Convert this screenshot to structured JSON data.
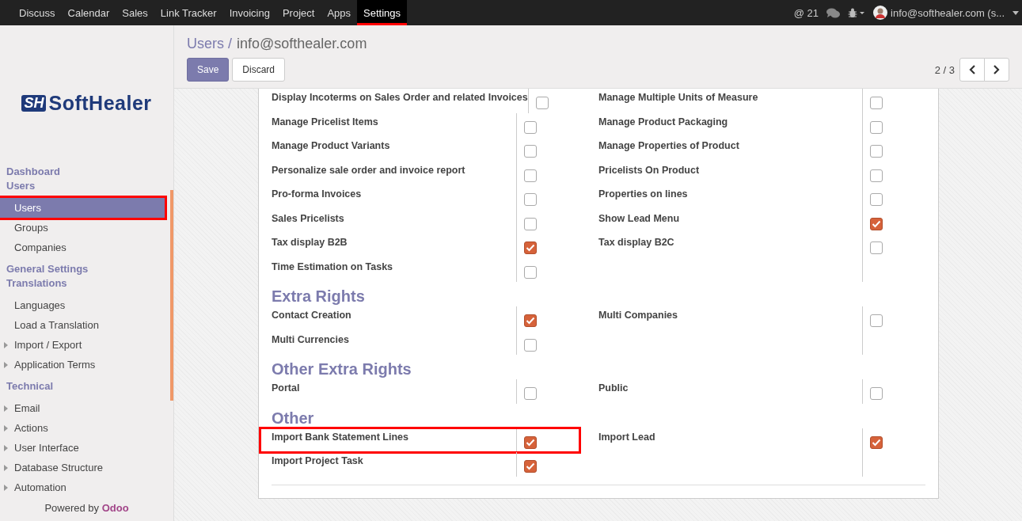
{
  "navbar": {
    "items": [
      {
        "label": "Discuss",
        "selected": false,
        "highlighted": false
      },
      {
        "label": "Calendar",
        "selected": false,
        "highlighted": false
      },
      {
        "label": "Sales",
        "selected": false,
        "highlighted": false
      },
      {
        "label": "Link Tracker",
        "selected": false,
        "highlighted": false
      },
      {
        "label": "Invoicing",
        "selected": false,
        "highlighted": false
      },
      {
        "label": "Project",
        "selected": false,
        "highlighted": false
      },
      {
        "label": "Apps",
        "selected": false,
        "highlighted": false
      },
      {
        "label": "Settings",
        "selected": true,
        "highlighted": true
      }
    ],
    "mentions": "@ 21",
    "user": "info@softhealer.com (s..."
  },
  "sidebar": {
    "logo": {
      "mark": "SH",
      "name": "SoftHealer"
    },
    "items": [
      {
        "kind": "header",
        "label": "Dashboard"
      },
      {
        "kind": "header",
        "label": "Users"
      },
      {
        "kind": "item",
        "label": "Users",
        "selected": true,
        "highlighted": true
      },
      {
        "kind": "item",
        "label": "Groups",
        "selected": false,
        "highlighted": false
      },
      {
        "kind": "item",
        "label": "Companies",
        "selected": false,
        "highlighted": false
      },
      {
        "kind": "header",
        "label": "General Settings"
      },
      {
        "kind": "header",
        "label": "Translations"
      },
      {
        "kind": "item",
        "label": "Languages",
        "selected": false,
        "highlighted": false
      },
      {
        "kind": "item",
        "label": "Load a Translation",
        "selected": false,
        "highlighted": false
      },
      {
        "kind": "folder",
        "label": "Import / Export",
        "selected": false,
        "highlighted": false
      },
      {
        "kind": "folder",
        "label": "Application Terms",
        "selected": false,
        "highlighted": false
      },
      {
        "kind": "header",
        "label": "Technical"
      },
      {
        "kind": "folder",
        "label": "Email",
        "selected": false,
        "highlighted": false
      },
      {
        "kind": "folder",
        "label": "Actions",
        "selected": false,
        "highlighted": false
      },
      {
        "kind": "folder",
        "label": "User Interface",
        "selected": false,
        "highlighted": false
      },
      {
        "kind": "folder",
        "label": "Database Structure",
        "selected": false,
        "highlighted": false
      },
      {
        "kind": "folder",
        "label": "Automation",
        "selected": false,
        "highlighted": false
      }
    ],
    "footer": "Powered by **Odoo**"
  },
  "breadcrumb": {
    "parent": "Users /",
    "current": "info@softhealer.com"
  },
  "buttons": [
    "Save",
    "Discard"
  ],
  "pager": "2 / 3",
  "sections": [
    {
      "rows": [
        {
          "left": {
            "label": "Display Incoterms on Sales Order and related Invoices",
            "checked": false
          },
          "right": {
            "label": "Manage Multiple Units of Measure",
            "checked": false
          }
        },
        {
          "left": {
            "label": "Manage Pricelist Items",
            "checked": false
          },
          "right": {
            "label": "Manage Product Packaging",
            "checked": false
          }
        },
        {
          "left": {
            "label": "Manage Product Variants",
            "checked": false
          },
          "right": {
            "label": "Manage Properties of Product",
            "checked": false
          }
        },
        {
          "left": {
            "label": "Personalize sale order and invoice report",
            "checked": false
          },
          "right": {
            "label": "Pricelists On Product",
            "checked": false
          }
        },
        {
          "left": {
            "label": "Pro-forma Invoices",
            "checked": false
          },
          "right": {
            "label": "Properties on lines",
            "checked": false
          }
        },
        {
          "left": {
            "label": "Sales Pricelists",
            "checked": false
          },
          "right": {
            "label": "Show Lead Menu",
            "checked": true
          }
        },
        {
          "left": {
            "label": "Tax display B2B",
            "checked": true
          },
          "right": {
            "label": "Tax display B2C",
            "checked": false
          }
        },
        {
          "left": {
            "label": "Time Estimation on Tasks",
            "checked": false
          }
        }
      ]
    },
    {
      "title": "Extra Rights",
      "rows": [
        {
          "left": {
            "label": "Contact Creation",
            "checked": true
          },
          "right": {
            "label": "Multi Companies",
            "checked": false
          }
        },
        {
          "left": {
            "label": "Multi Currencies",
            "checked": false
          }
        }
      ]
    },
    {
      "title": "Other Extra Rights",
      "rows": [
        {
          "left": {
            "label": "Portal",
            "checked": false
          },
          "right": {
            "label": "Public",
            "checked": false
          }
        }
      ]
    },
    {
      "title": "Other",
      "rows": [
        {
          "left": {
            "label": "Import Bank Statement Lines",
            "checked": true,
            "highlighted": true
          },
          "right": {
            "label": "Import Lead",
            "checked": true
          }
        },
        {
          "left": {
            "label": "Import Project Task",
            "checked": true
          }
        }
      ]
    }
  ]
}
